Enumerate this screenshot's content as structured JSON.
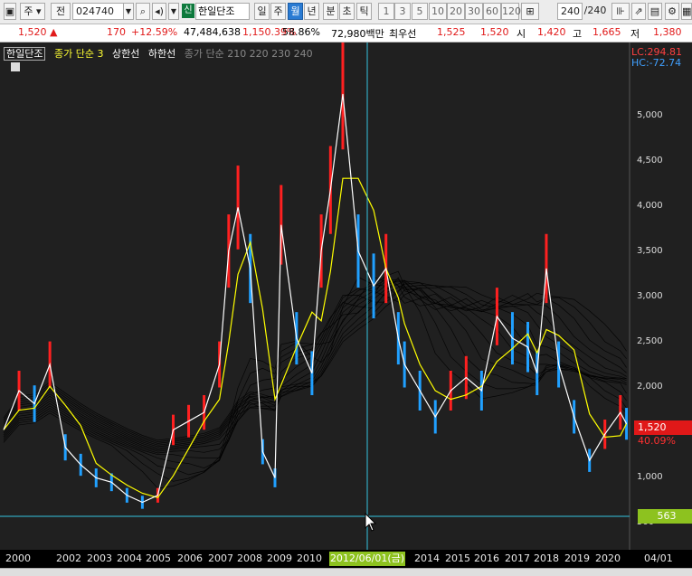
{
  "toolbar": {
    "period_code": "주",
    "type_code": "전",
    "code": "024740",
    "stock_badge": "신",
    "stock_name": "한일단조",
    "periods": [
      "일",
      "주",
      "월",
      "년",
      "분",
      "초",
      "틱"
    ],
    "active_period": "월",
    "intervals": [
      "1",
      "3",
      "5",
      "10",
      "20",
      "30",
      "60",
      "120"
    ],
    "count": "240",
    "count_total": "/240"
  },
  "quote": {
    "price": "1,520",
    "up_mark": "▲",
    "change": "170",
    "change_pct": "+12.59%",
    "volume": "47,484,638",
    "volume_pct": "1,150.39%",
    "ratio": "58.86%",
    "amount": "72,980백만",
    "label_priority": "최우선",
    "ask": "1,525",
    "bid": "1,520",
    "open_label": "시",
    "open": "1,420",
    "high_label": "고",
    "high": "1,665",
    "low_label": "저",
    "low": "1,380"
  },
  "legend": {
    "name": "한일단조",
    "ma": "종가 단순 3",
    "upper": "상한선",
    "lower": "하한선",
    "ma_multi": "종가 단순 210 220 230 240"
  },
  "right_panel": {
    "lc": "LC:294.81",
    "hc": "HC:-72.74",
    "yticks": [
      "5,000",
      "4,500",
      "4,000",
      "3,500",
      "3,000",
      "2,500",
      "2,000",
      "1,500",
      "1,000",
      "500"
    ],
    "price_tag": "1,520",
    "pct_tag": "40.09%",
    "cursor_value": "563",
    "date_right": "04/01"
  },
  "cursor_date": "2012/06/01(금)",
  "x_labels": [
    "2000",
    "2002",
    "2003",
    "2004",
    "2005",
    "2006",
    "2007",
    "2008",
    "2009",
    "2010",
    "2014",
    "2015",
    "2016",
    "2017",
    "2018",
    "2019",
    "2020"
  ],
  "chart_data": {
    "type": "line",
    "y_range": [
      480,
      5600
    ],
    "colors": {
      "price": "#ffffff",
      "ma": "#ffff00",
      "bar_up": "#ff2020",
      "bar_dn": "#20a0ff",
      "env": "#000000"
    },
    "series": [
      {
        "name": "",
        "x": [
          2000,
          2000.5,
          2001,
          2001.5,
          2002,
          2002.5,
          2003,
          2003.5,
          2004,
          2004.5,
          2005,
          2005.5,
          2006,
          2006.5,
          2007,
          2007.3,
          2007.6,
          2008,
          2008.4,
          2008.8,
          2009,
          2009.5,
          2010,
          2010.3,
          2010.6,
          2011,
          2011.5,
          2012,
          2012.4,
          2012.8,
          2013,
          2013.5,
          2014,
          2014.5,
          2015,
          2015.5,
          2016,
          2016.5,
          2017,
          2017.3,
          2017.6,
          2018,
          2018.5,
          2019,
          2019.5,
          2020,
          2020.2
        ],
        "y": [
          1450,
          1900,
          1750,
          2200,
          1250,
          1050,
          900,
          850,
          700,
          620,
          700,
          1450,
          1550,
          1650,
          2200,
          3500,
          4000,
          3300,
          1200,
          900,
          3800,
          2500,
          2100,
          3500,
          4200,
          5300,
          3500,
          3100,
          3300,
          2500,
          2200,
          1900,
          1600,
          1900,
          2050,
          1900,
          2750,
          2500,
          2400,
          2100,
          3300,
          2200,
          1600,
          1100,
          1400,
          1650,
          1520
        ]
      }
    ]
  }
}
